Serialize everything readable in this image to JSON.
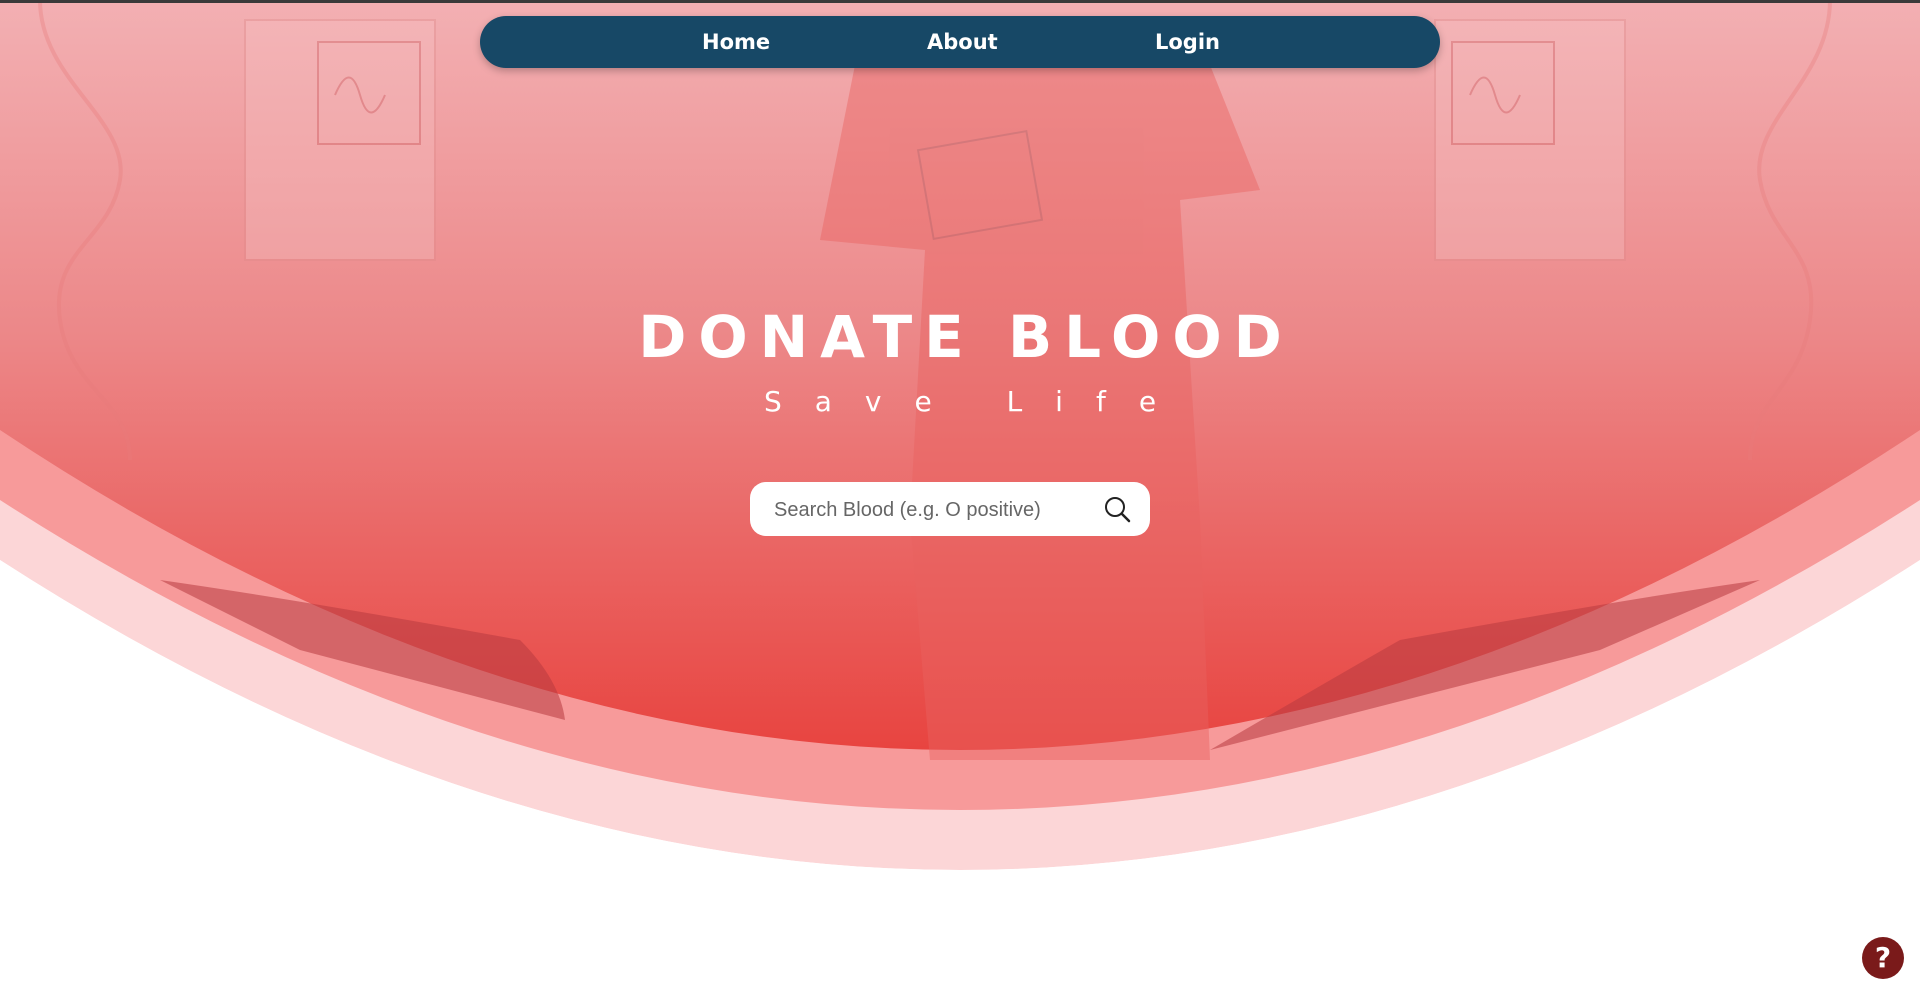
{
  "nav": {
    "items": [
      {
        "label": "Home"
      },
      {
        "label": "About"
      },
      {
        "label": "Login"
      }
    ]
  },
  "hero": {
    "title": "DONATE BLOOD",
    "subtitle": "Save Life"
  },
  "search": {
    "placeholder": "Search Blood (e.g. O positive)",
    "value": "",
    "icon": "search-icon"
  },
  "help": {
    "label": "?",
    "icon": "question-icon"
  },
  "colors": {
    "nav_bg": "#174866",
    "hero_top": "#f1a2a6",
    "hero_bottom": "#e84440",
    "band_mid": "#f79a9a",
    "band_outer": "#fcd6d7",
    "help_bg": "#7a1a1a"
  }
}
